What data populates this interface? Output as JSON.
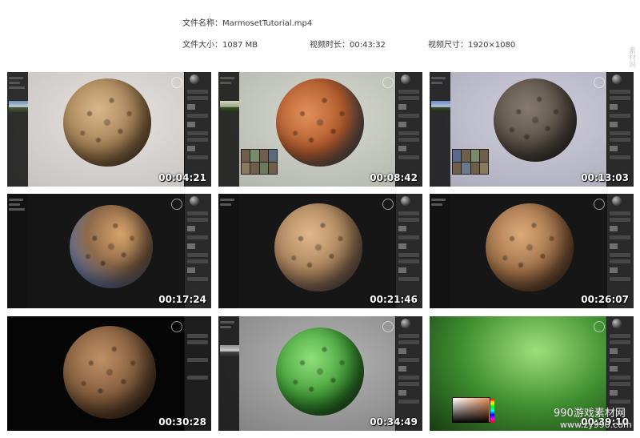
{
  "header": {
    "filename_label": "文件名称：",
    "filename_value": "MarmosetTutorial.mp4",
    "filesize_label": "文件大小：",
    "filesize_value": "1087 MB",
    "duration_label": "视频时长：",
    "duration_value": "00:43:32",
    "resolution_label": "视频尺寸：",
    "resolution_value": "1920×1080"
  },
  "thumbnails": [
    {
      "timestamp": "00:04:21",
      "background": "#d7d3d1",
      "sphere": "sand"
    },
    {
      "timestamp": "00:08:42",
      "background": "#c9cbc4",
      "sphere": "orange"
    },
    {
      "timestamp": "00:13:03",
      "background": "#b9b9c6",
      "sphere": "gray"
    },
    {
      "timestamp": "00:17:24",
      "background": "#151515",
      "sphere": "blue-sand"
    },
    {
      "timestamp": "00:21:46",
      "background": "#151515",
      "sphere": "sand"
    },
    {
      "timestamp": "00:26:07",
      "background": "#151515",
      "sphere": "sand-dark"
    },
    {
      "timestamp": "00:30:28",
      "background": "#050505",
      "sphere": "dark"
    },
    {
      "timestamp": "00:34:49",
      "background": "#9a9a9a",
      "sphere": "green"
    },
    {
      "timestamp": "00:39:10",
      "background": "#2c2c2c",
      "sphere": "grass-plane"
    }
  ],
  "watermark": {
    "line1": "990游戏素材网",
    "line2": "www.zy990.com"
  },
  "side_watermark": "素材网"
}
